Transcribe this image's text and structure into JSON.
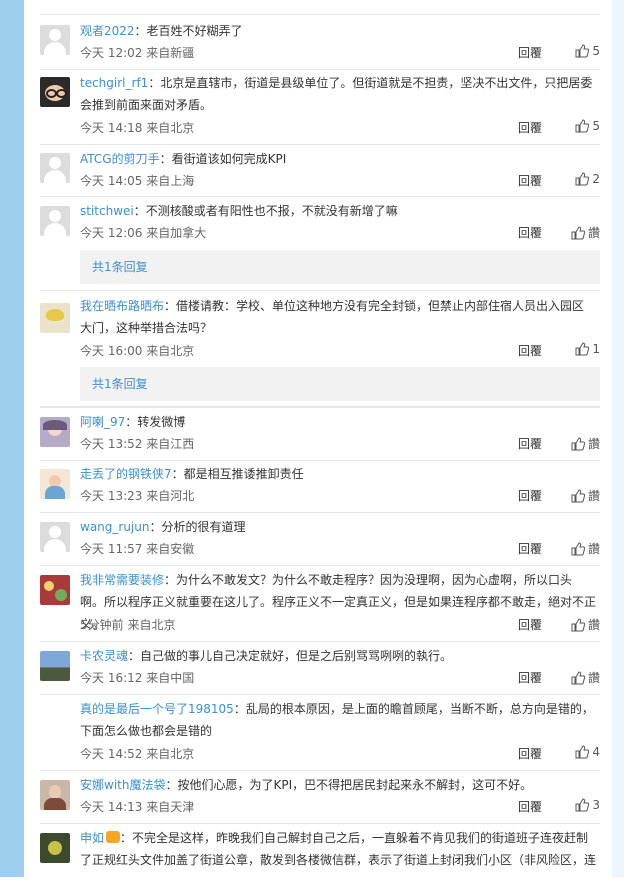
{
  "reply_label": "回覆",
  "colors": {
    "accent": "#3b8fd4",
    "rail": "#9dd0ee"
  },
  "icons": {
    "like": "thumb-up-icon",
    "avatar": "avatar"
  },
  "comments": [
    {
      "user": "观者2022",
      "text": "：老百姓不好糊弄了",
      "time": "今天 12:02 来自新疆",
      "likes": "5"
    },
    {
      "user": "techgirl_rf1",
      "text": "：北京是直辖市，街道是县级单位了。但街道就是不担责，坚决不出文件，只把居委会推到前面来面对矛盾。",
      "time": "今天 14:18 来自北京",
      "likes": "5"
    },
    {
      "user": "ATCG的剪刀手",
      "text": "：看街道该如何完成KPI",
      "time": "今天 14:05 来自上海",
      "likes": "2"
    },
    {
      "user": "stitchwei",
      "text": "：不测核酸或者有阳性也不报，不就没有新增了嘛",
      "time": "今天 12:06 来自加拿大",
      "likes": "讚",
      "subreply": "共1条回复"
    },
    {
      "user": "我在晒布路晒布",
      "text": "：借楼请教：学校、单位这种地方没有完全封锁，但禁止内部住宿人员出入园区大门，这种举措合法吗？",
      "time": "今天 16:00 来自北京",
      "likes": "1",
      "subreply": "共1条回复"
    },
    {
      "user": "阿喇_97",
      "text": "：转发微博",
      "time": "今天 13:52 来自江西",
      "likes": "讚"
    },
    {
      "user": "走丢了的钢铁侠7",
      "text": "：都是相互推诿推卸责任",
      "time": "今天 13:23 来自河北",
      "likes": "讚"
    },
    {
      "user": "wang_rujun",
      "text": "：分析的很有道理",
      "time": "今天 11:57 来自安徽",
      "likes": "讚"
    },
    {
      "user": "我非常需要装修",
      "text": "：为什么不敢发文？为什么不敢走程序？因为没理啊，因为心虚啊，所以口头啊。所以程序正义就重要在这儿了。程序正义不一定真正义，但是如果连程序都不敢走，絕对不正义。",
      "time": "5分钟前 来自北京",
      "likes": "讚"
    },
    {
      "user": "卡农灵魂",
      "text": "：自己做的事儿自己决定就好，但是之后别骂骂咧咧的執行。",
      "time": "今天 16:12 来自中国",
      "likes": "讚"
    },
    {
      "user": "真的是最后一个号了198105",
      "text": "：乱局的根本原因，是上面的瞻首顾尾，当断不断，总方向是错的，下面怎么做也都会是错的",
      "time": "今天 14:52 来自北京",
      "likes": "4"
    },
    {
      "user": "安娜with魔法袋",
      "text": "：按他们心愿，为了KPI，巴不得把居民封起来永不解封，这可不好。",
      "time": "今天 14:13 来自天津",
      "likes": "3"
    },
    {
      "user": "申如",
      "text": "：不完全是这样，昨晚我们自己解封自己之后，一直躲着不肯见我们的街道班子连夜赶制了正规红头文件加盖了街道公章，散发到各楼微信群，表示了街道上封闭我们小区（非风险区，连",
      "time": "",
      "likes": ""
    }
  ]
}
